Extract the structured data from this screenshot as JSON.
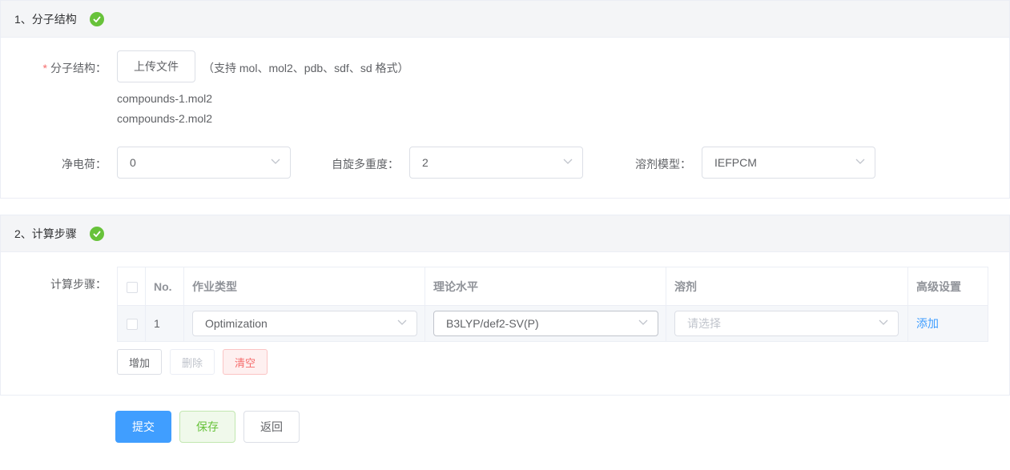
{
  "section1": {
    "title": "1、分子结构",
    "structure_label": "分子结构：",
    "required_mark": "*",
    "upload_button": "上传文件",
    "format_hint": "（支持 mol、mol2、pdb、sdf、sd 格式）",
    "files": [
      "compounds-1.mol2",
      "compounds-2.mol2"
    ],
    "charge_label": "净电荷：",
    "charge_value": "0",
    "spin_label": "自旋多重度：",
    "spin_value": "2",
    "solvent_model_label": "溶剂模型：",
    "solvent_model_value": "IEFPCM"
  },
  "section2": {
    "title": "2、计算步骤",
    "steps_label": "计算步骤：",
    "table": {
      "headers": [
        "",
        "No.",
        "作业类型",
        "理论水平",
        "溶剂",
        "高级设置"
      ],
      "rows": [
        {
          "no": "1",
          "job_type": "Optimization",
          "theory": "B3LYP/def2-SV(P)",
          "solvent_placeholder": "请选择",
          "action": "添加"
        }
      ]
    },
    "add_button": "增加",
    "delete_button": "删除",
    "clear_button": "清空"
  },
  "footer": {
    "submit_button": "提交",
    "save_button": "保存",
    "back_button": "返回"
  },
  "colors": {
    "primary": "#409eff",
    "success": "#67c23a",
    "danger": "#f56c6c",
    "header_bg": "#f4f5f7"
  },
  "icons": {
    "check": "check-circle-icon",
    "dropdown": "chevron-down-icon"
  }
}
